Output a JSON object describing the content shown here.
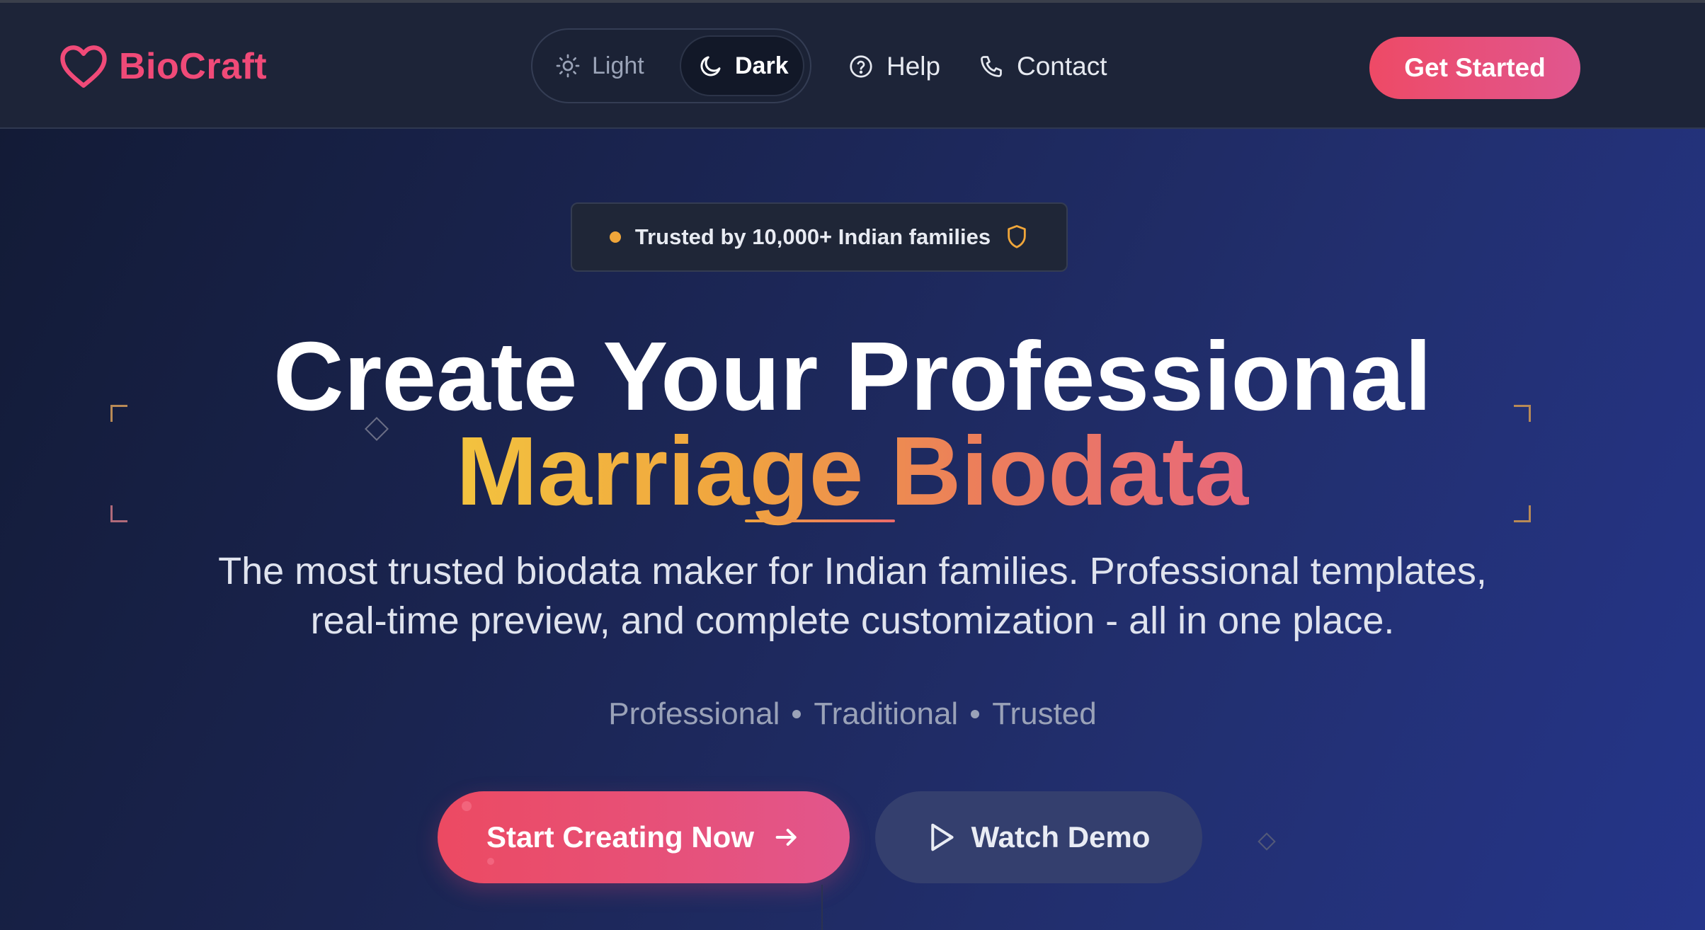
{
  "navbar": {
    "brand": {
      "name": "BioCraft",
      "icon": "heart-icon",
      "color": "#f04a78"
    },
    "theme_toggle": {
      "light_label": "Light",
      "light_icon": "sun-icon",
      "dark_label": "Dark",
      "dark_icon": "moon-icon",
      "selected": "Dark"
    },
    "links": [
      {
        "label": "Help",
        "icon": "help-circle-icon"
      },
      {
        "label": "Contact",
        "icon": "phone-icon"
      }
    ],
    "cta_label": "Get Started"
  },
  "hero": {
    "badge": {
      "text": "Trusted by 10,000+ Indian families",
      "dot_color": "#f0a63a",
      "icon": "shield-icon"
    },
    "title_line1": "Create Your Professional",
    "title_line2": "Marriage Biodata",
    "subtitle_line1": "The most trusted biodata maker for Indian families. Professional templates,",
    "subtitle_line2": "real-time preview, and complete customization - all in one place.",
    "tags": [
      "Professional",
      "Traditional",
      "Trusted"
    ],
    "primary_cta": {
      "label": "Start Creating Now",
      "icon": "arrow-right-icon"
    },
    "secondary_cta": {
      "label": "Watch Demo",
      "icon": "play-icon"
    }
  },
  "colors": {
    "accent_pink": "#ec4a62",
    "accent_gold": "#f3c33f",
    "background_dark": "#121a34"
  }
}
